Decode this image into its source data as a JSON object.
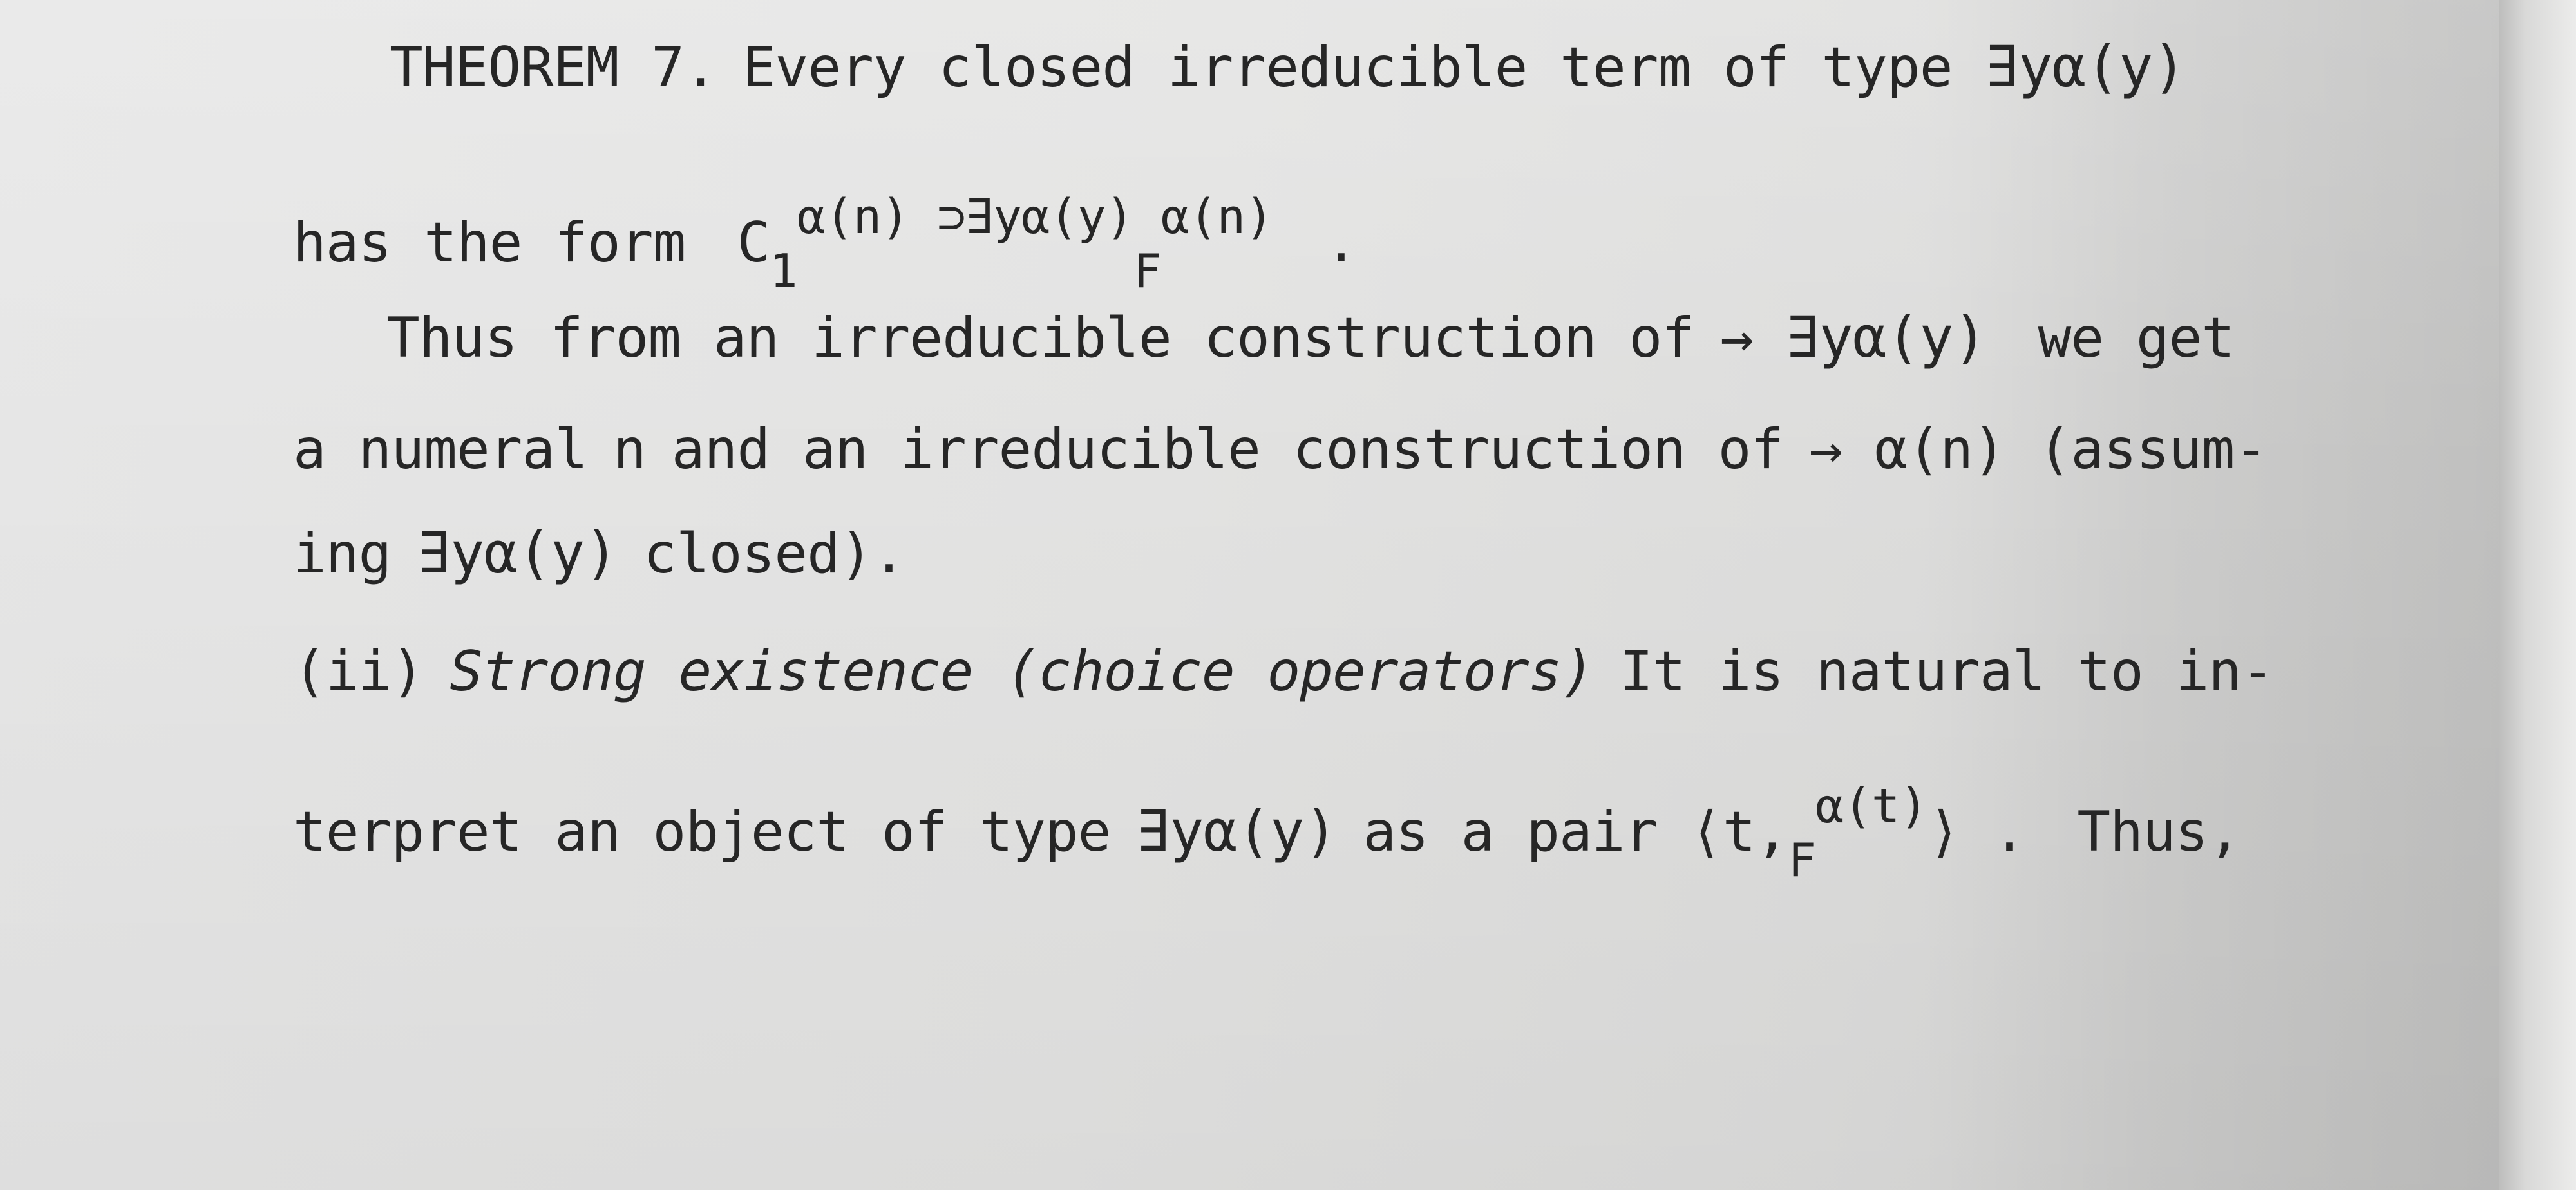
{
  "theorem": {
    "label": "THEOREM 7.",
    "statement": "Every closed irreducible term of type",
    "formula": "∃yα(y)"
  },
  "form_line": {
    "text": "has the form",
    "c_base": "C",
    "c_sub": "1",
    "c_sup": "α(n) ⊃∃yα(y)",
    "f_base": "F",
    "f_sup": "α(n)",
    "end": "."
  },
  "thus_line": {
    "text": "Thus from an irreducible construction of",
    "arrow": "→",
    "formula": "∃yα(y)",
    "end": "we get"
  },
  "numeral_line": {
    "text1": "a numeral",
    "var": "n",
    "text2": "and an irreducible construction of",
    "arrow": "→",
    "formula": "α(n)",
    "end": "(assum-"
  },
  "assuming_line": {
    "text1": "ing",
    "formula": "∃yα(y)",
    "text2": "closed)."
  },
  "section": {
    "number": "(ii)",
    "title": "Strong existence (choice operators)",
    "text": "It is natural to in-"
  },
  "interpret_line": {
    "text1": "terpret an object of type",
    "formula": "∃yα(y)",
    "text2": "as a pair",
    "open": "⟨",
    "t": "t,",
    "f_base": "F",
    "f_sup": "α(t)",
    "close": "⟩",
    "dot": ".",
    "end": "Thus,"
  }
}
